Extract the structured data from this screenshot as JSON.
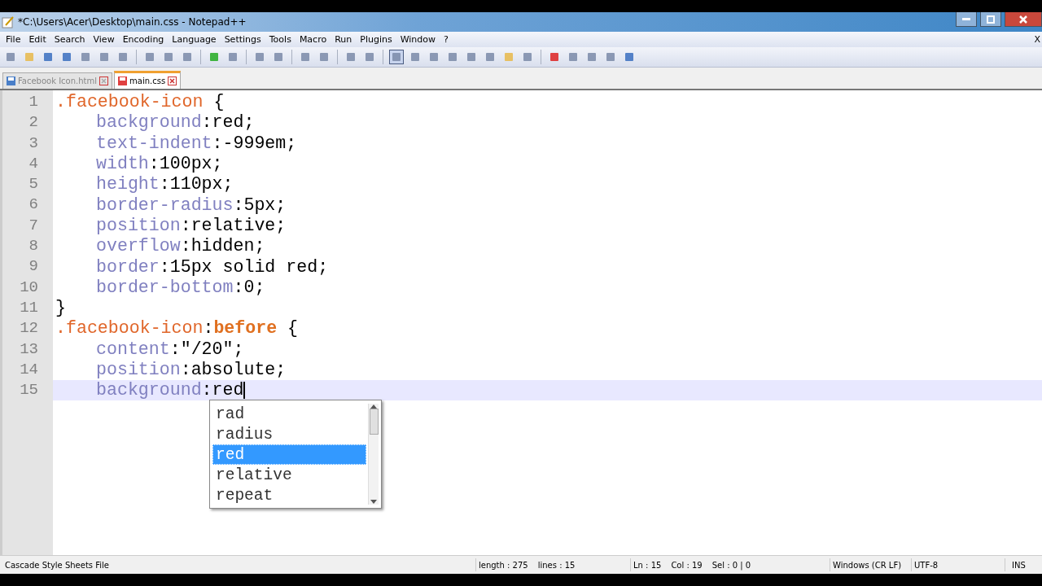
{
  "window": {
    "title": "*C:\\Users\\Acer\\Desktop\\main.css - Notepad++"
  },
  "menu": [
    "File",
    "Edit",
    "Search",
    "View",
    "Encoding",
    "Language",
    "Settings",
    "Tools",
    "Macro",
    "Run",
    "Plugins",
    "Window",
    "?"
  ],
  "menu_close": "X",
  "tabs": [
    {
      "label": "Facebook Icon.html",
      "selected": false,
      "modified": false
    },
    {
      "label": "main.css",
      "selected": true,
      "modified": true
    }
  ],
  "lines": [
    {
      "number": "1",
      "indented": false,
      "current": false,
      "tokens": [
        {
          "kind": "selector",
          "text": ".facebook-icon"
        },
        {
          "kind": "plain",
          "text": " {"
        }
      ]
    },
    {
      "number": "2",
      "indented": true,
      "current": false,
      "tokens": [
        {
          "kind": "property",
          "text": "background"
        },
        {
          "kind": "plain",
          "text": ":red;"
        }
      ]
    },
    {
      "number": "3",
      "indented": true,
      "current": false,
      "tokens": [
        {
          "kind": "property",
          "text": "text-indent"
        },
        {
          "kind": "plain",
          "text": ":-999em;"
        }
      ]
    },
    {
      "number": "4",
      "indented": true,
      "current": false,
      "tokens": [
        {
          "kind": "property",
          "text": "width"
        },
        {
          "kind": "plain",
          "text": ":100px;"
        }
      ]
    },
    {
      "number": "5",
      "indented": true,
      "current": false,
      "tokens": [
        {
          "kind": "property",
          "text": "height"
        },
        {
          "kind": "plain",
          "text": ":110px;"
        }
      ]
    },
    {
      "number": "6",
      "indented": true,
      "current": false,
      "tokens": [
        {
          "kind": "property",
          "text": "border-radius"
        },
        {
          "kind": "plain",
          "text": ":5px;"
        }
      ]
    },
    {
      "number": "7",
      "indented": true,
      "current": false,
      "tokens": [
        {
          "kind": "property",
          "text": "position"
        },
        {
          "kind": "plain",
          "text": ":relative;"
        }
      ]
    },
    {
      "number": "8",
      "indented": true,
      "current": false,
      "tokens": [
        {
          "kind": "property",
          "text": "overflow"
        },
        {
          "kind": "plain",
          "text": ":hidden;"
        }
      ]
    },
    {
      "number": "9",
      "indented": true,
      "current": false,
      "tokens": [
        {
          "kind": "property",
          "text": "border"
        },
        {
          "kind": "plain",
          "text": ":15px solid red;"
        }
      ]
    },
    {
      "number": "10",
      "indented": true,
      "current": false,
      "tokens": [
        {
          "kind": "property",
          "text": "border-bottom"
        },
        {
          "kind": "plain",
          "text": ":0;"
        }
      ]
    },
    {
      "number": "11",
      "indented": false,
      "current": false,
      "tokens": [
        {
          "kind": "plain",
          "text": "}"
        }
      ]
    },
    {
      "number": "12",
      "indented": false,
      "current": false,
      "tokens": [
        {
          "kind": "selector",
          "text": ".facebook-icon"
        },
        {
          "kind": "plain",
          "text": ":"
        },
        {
          "kind": "pseudo",
          "text": "before"
        },
        {
          "kind": "plain",
          "text": " {"
        }
      ]
    },
    {
      "number": "13",
      "indented": true,
      "current": false,
      "tokens": [
        {
          "kind": "property",
          "text": "content"
        },
        {
          "kind": "plain",
          "text": ":\"/20\";"
        }
      ]
    },
    {
      "number": "14",
      "indented": true,
      "current": false,
      "tokens": [
        {
          "kind": "property",
          "text": "position"
        },
        {
          "kind": "plain",
          "text": ":absolute;"
        }
      ]
    },
    {
      "number": "15",
      "indented": true,
      "current": true,
      "tokens": [
        {
          "kind": "property",
          "text": "background"
        },
        {
          "kind": "plain",
          "text": ":red"
        }
      ]
    }
  ],
  "autocomplete": [
    {
      "label": "rad",
      "selected": false
    },
    {
      "label": "radius",
      "selected": false
    },
    {
      "label": "red",
      "selected": true
    },
    {
      "label": "relative",
      "selected": false
    },
    {
      "label": "repeat",
      "selected": false
    }
  ],
  "status_bar": {
    "file_type": "Cascade Style Sheets File",
    "length": "length : 275",
    "lines": "lines : 15",
    "position": [
      "Ln : 15",
      "Col : 19",
      "Sel : 0 | 0"
    ],
    "eol": "Windows (CR LF)",
    "encoding": "UTF-8",
    "mode": "INS"
  }
}
